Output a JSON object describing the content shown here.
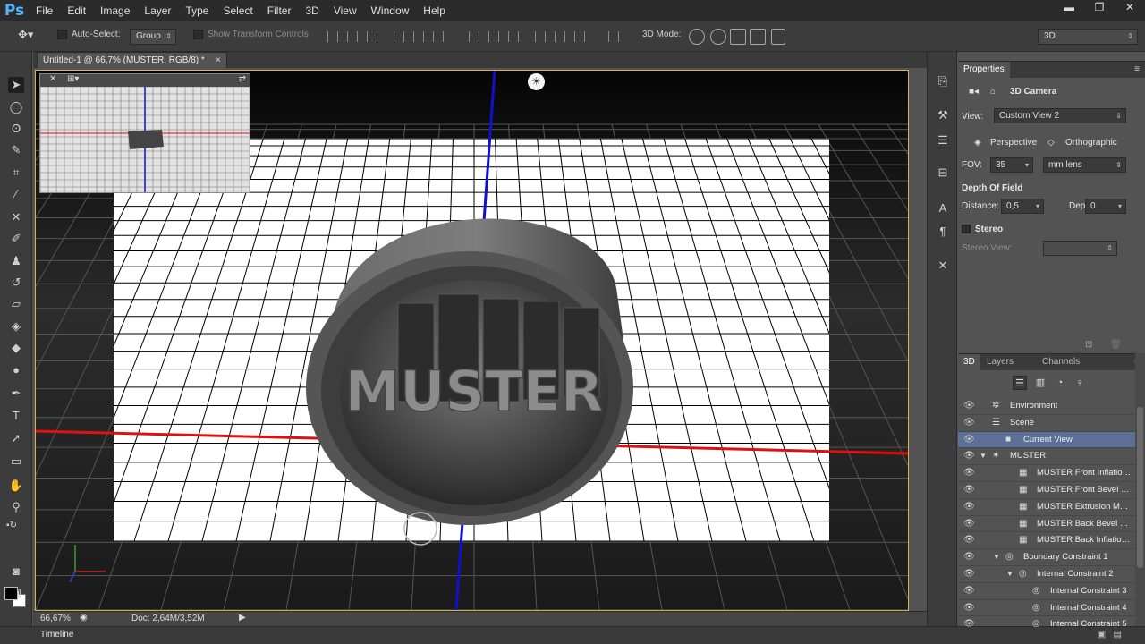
{
  "app": {
    "logo": "Ps"
  },
  "menu": [
    "File",
    "Edit",
    "Image",
    "Layer",
    "Type",
    "Select",
    "Filter",
    "3D",
    "View",
    "Window",
    "Help"
  ],
  "window_controls": {
    "minimize": "▬",
    "restore": "❐",
    "close": "✕"
  },
  "options_bar": {
    "auto_select_label": "Auto-Select:",
    "auto_select_value": "Group",
    "show_transform_label": "Show Transform Controls",
    "mode_label": "3D Mode:",
    "workspace": "3D"
  },
  "document": {
    "tab_title": "Untitled-1 @ 66,7% (MUSTER, RGB/8) *",
    "close": "×"
  },
  "canvas": {
    "model_text": "MUSTER",
    "colors": {
      "grid": "#000000",
      "x_axis": "#e01010",
      "y_axis": "#1010d0",
      "frame": "#d5b54a",
      "cylinder": "#5e5e5e"
    }
  },
  "status": {
    "zoom": "66,67%",
    "doc": "Doc: 2,64M/3,52M"
  },
  "timeline": {
    "label": "Timeline"
  },
  "properties": {
    "tab": "Properties",
    "camera_title": "3D Camera",
    "view_label": "View:",
    "view_value": "Custom View 2",
    "perspective": "Perspective",
    "orthographic": "Orthographic",
    "fov_label": "FOV:",
    "fov_value": "35",
    "lens_value": "mm lens",
    "dof_title": "Depth Of Field",
    "distance_label": "Distance:",
    "distance_value": "0,5",
    "depth_label": "Depth:",
    "depth_value": "0",
    "stereo_label": "Stereo",
    "stereo_view_label": "Stereo View:"
  },
  "layers_panel": {
    "tabs": [
      "3D",
      "Layers",
      "Channels"
    ],
    "items": [
      {
        "label": "Environment",
        "indent": 0,
        "icon": "environment-icon",
        "twisty": ""
      },
      {
        "label": "Scene",
        "indent": 0,
        "icon": "scene-icon",
        "twisty": ""
      },
      {
        "label": "Current View",
        "indent": 1,
        "icon": "camera-icon",
        "twisty": "",
        "selected": true
      },
      {
        "label": "MUSTER",
        "indent": 0,
        "icon": "mesh-icon",
        "twisty": "▼"
      },
      {
        "label": "MUSTER Front Inflation M...",
        "indent": 2,
        "icon": "material-icon",
        "twisty": ""
      },
      {
        "label": "MUSTER Front Bevel Mat...",
        "indent": 2,
        "icon": "material-icon",
        "twisty": ""
      },
      {
        "label": "MUSTER Extrusion Material",
        "indent": 2,
        "icon": "material-icon",
        "twisty": ""
      },
      {
        "label": "MUSTER Back Bevel Mate...",
        "indent": 2,
        "icon": "material-icon",
        "twisty": ""
      },
      {
        "label": "MUSTER Back Inflation M...",
        "indent": 2,
        "icon": "material-icon",
        "twisty": ""
      },
      {
        "label": "Boundary Constraint 1",
        "indent": 1,
        "icon": "constraint-icon",
        "twisty": "▼"
      },
      {
        "label": "Internal Constraint 2",
        "indent": 2,
        "icon": "constraint-icon",
        "twisty": "▼"
      },
      {
        "label": "Internal Constraint 3",
        "indent": 3,
        "icon": "constraint-icon",
        "twisty": ""
      },
      {
        "label": "Internal Constraint 4",
        "indent": 3,
        "icon": "constraint-icon",
        "twisty": ""
      },
      {
        "label": "Internal Constraint 5",
        "indent": 3,
        "icon": "constraint-icon",
        "twisty": ""
      }
    ]
  }
}
